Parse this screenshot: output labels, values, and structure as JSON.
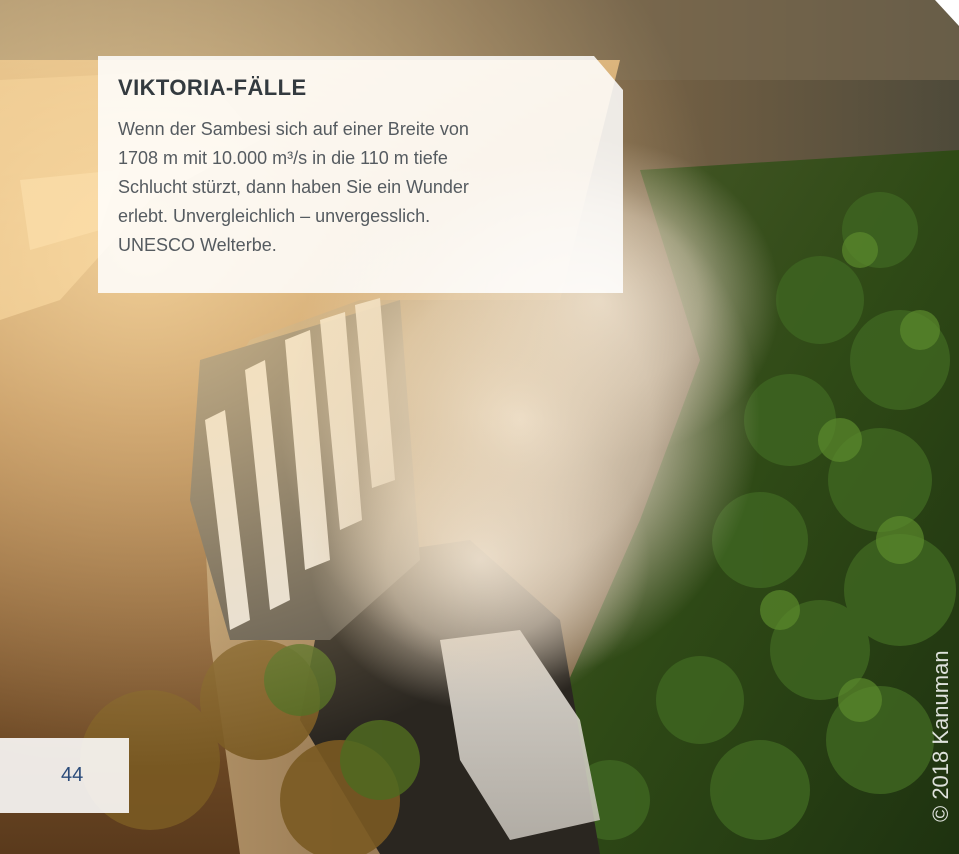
{
  "article": {
    "title": "VIKTORIA-FÄLLE",
    "body_lines": [
      "Wenn der Sambesi sich auf einer Breite von",
      "1708 m mit 10.000 m³/s in die 110 m tiefe",
      "Schlucht stürzt, dann haben Sie ein Wunder",
      "erlebt. Unvergleichlich – unvergesslich.",
      "UNESCO Welterbe."
    ]
  },
  "page_number": "44",
  "photo_credit": "© 2018 Kanuman",
  "colors": {
    "title": "#333a3f",
    "body_text": "#555b60",
    "page_number": "#2b4b7a",
    "forest": "#2f4a16",
    "mist": "#e8ddd0",
    "sunlit_rock": "#b8864a"
  }
}
